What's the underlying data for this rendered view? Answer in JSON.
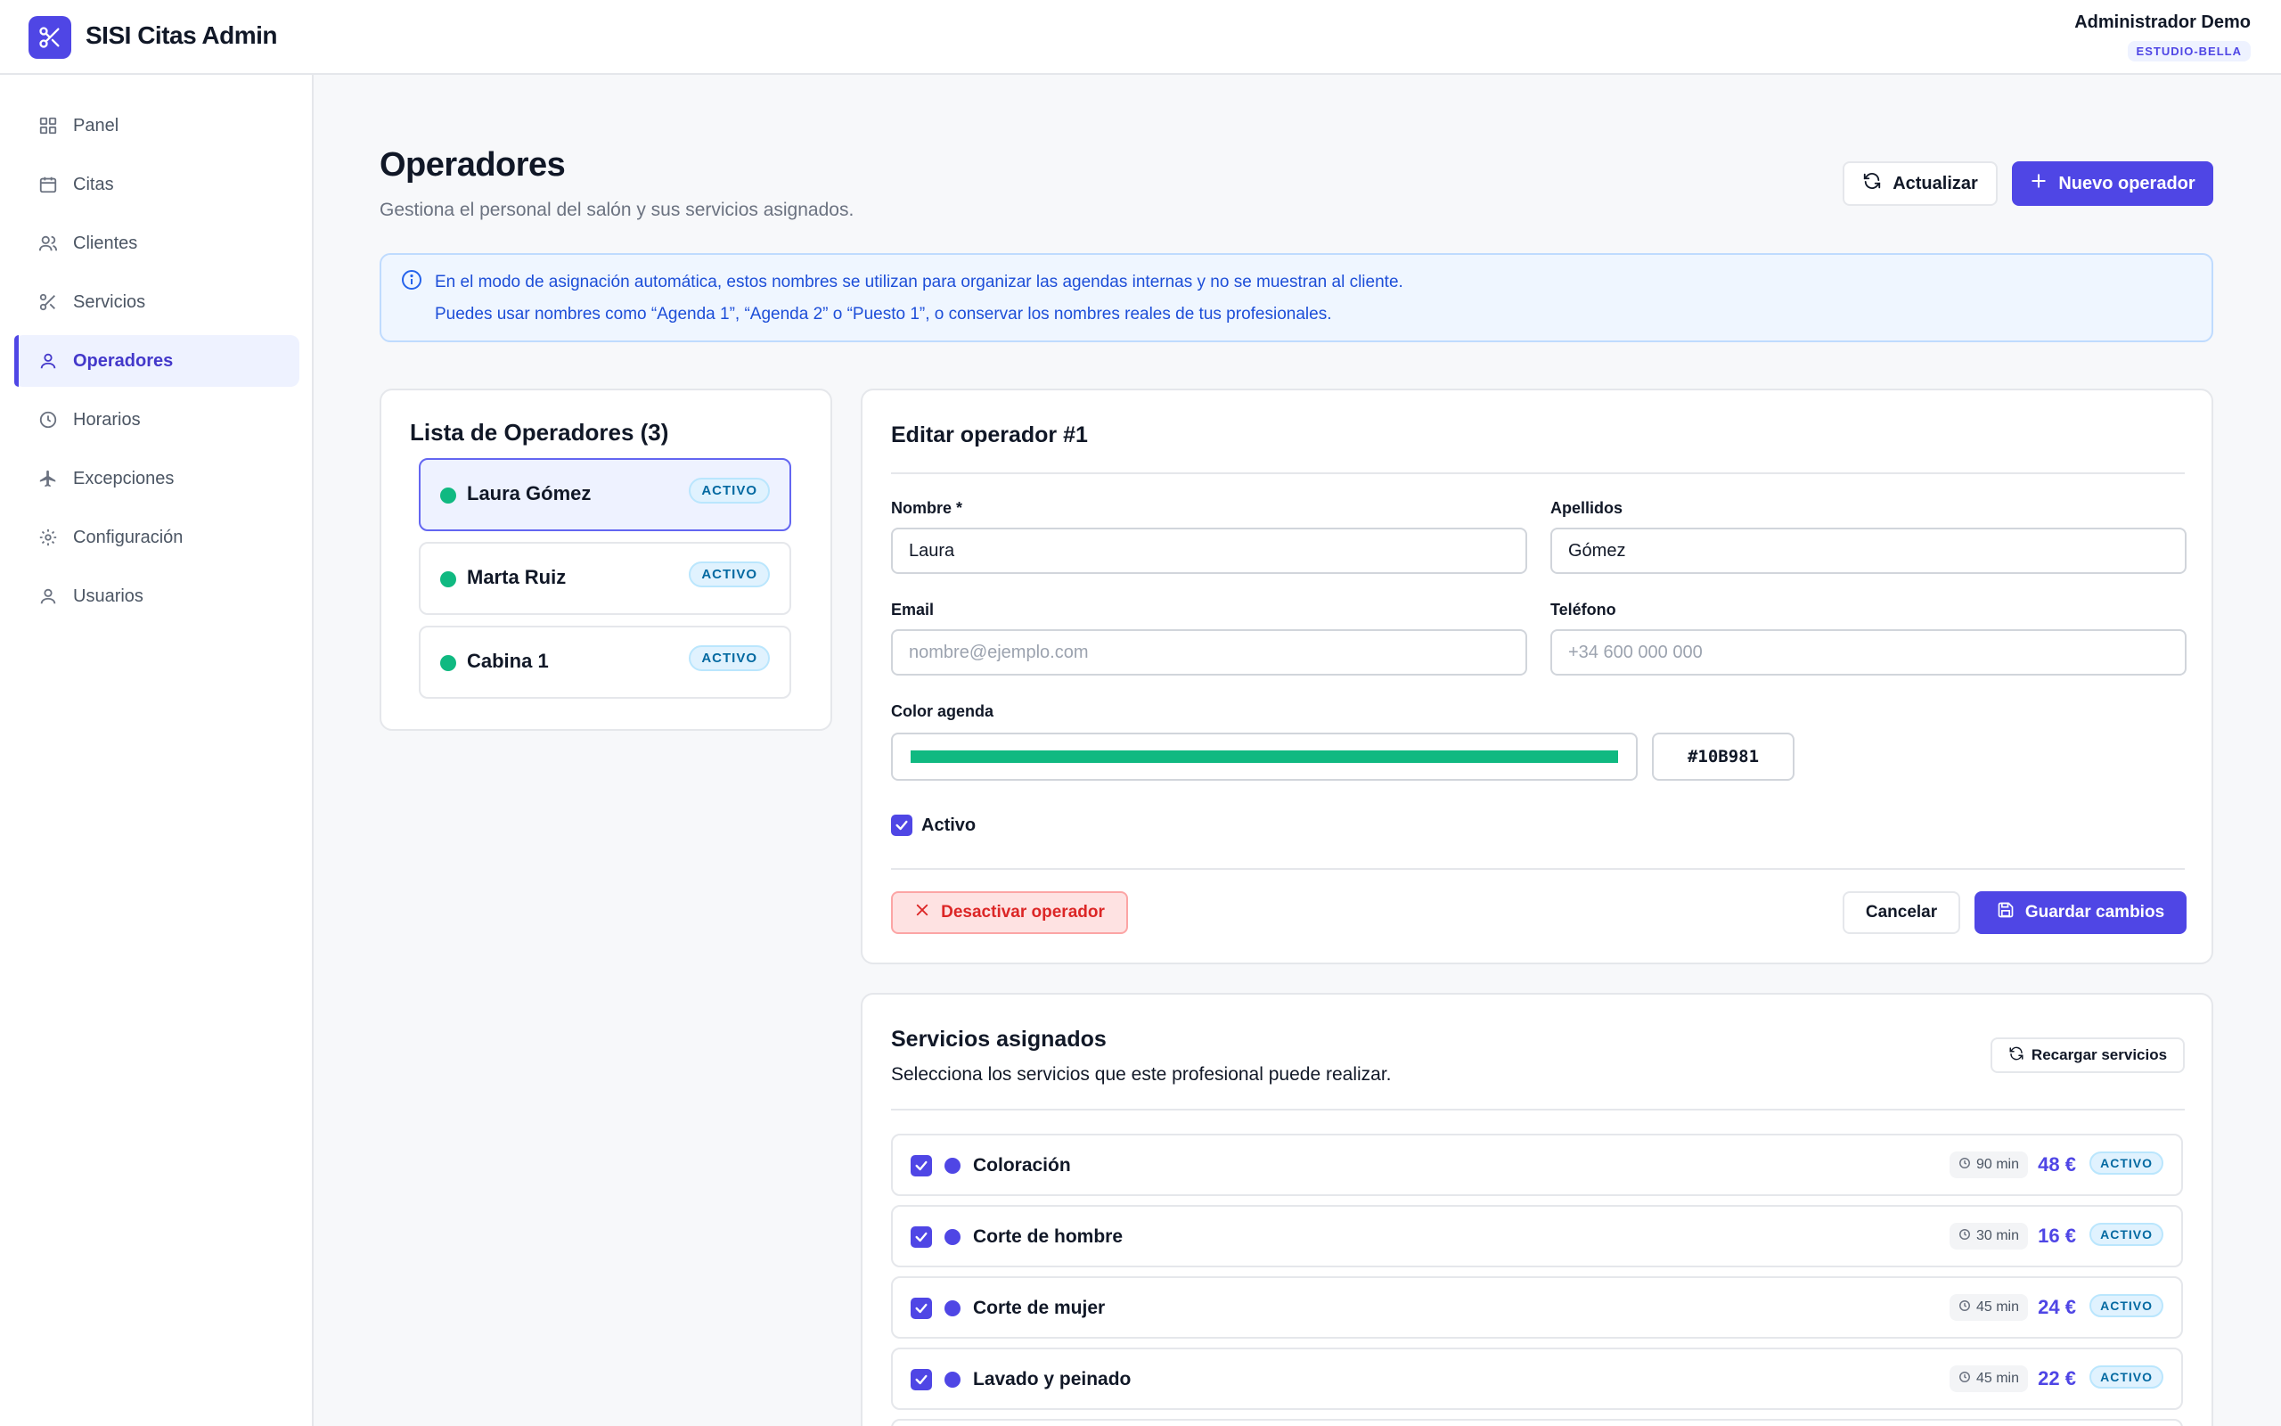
{
  "app": {
    "title": "SISI Citas Admin"
  },
  "user": {
    "name": "Administrador Demo",
    "tenant": "ESTUDIO-BELLA"
  },
  "sidebar": {
    "items": [
      {
        "label": "Panel",
        "icon": "grid-icon"
      },
      {
        "label": "Citas",
        "icon": "calendar-icon"
      },
      {
        "label": "Clientes",
        "icon": "users-icon"
      },
      {
        "label": "Servicios",
        "icon": "scissors-icon"
      },
      {
        "label": "Operadores",
        "icon": "user-icon",
        "active": true
      },
      {
        "label": "Horarios",
        "icon": "clock-icon"
      },
      {
        "label": "Excepciones",
        "icon": "plane-icon"
      },
      {
        "label": "Configuración",
        "icon": "gear-icon"
      },
      {
        "label": "Usuarios",
        "icon": "user-icon"
      }
    ]
  },
  "page": {
    "title": "Operadores",
    "subtitle": "Gestiona el personal del salón y sus servicios asignados.",
    "refresh_label": "Actualizar",
    "new_label": "Nuevo operador"
  },
  "info": {
    "line1": "En el modo de asignación automática, estos nombres se utilizan para organizar las agendas internas y no se muestran al cliente.",
    "line2": "Puedes usar nombres como “Agenda 1”, “Agenda 2” o “Puesto 1”, o conservar los nombres reales de tus profesionales."
  },
  "operator_list": {
    "title": "Lista de Operadores (3)",
    "items": [
      {
        "name": "Laura Gómez",
        "status": "ACTIVO",
        "selected": true
      },
      {
        "name": "Marta Ruiz",
        "status": "ACTIVO"
      },
      {
        "name": "Cabina 1",
        "status": "ACTIVO"
      }
    ]
  },
  "edit": {
    "title": "Editar operador #1",
    "nombre_label": "Nombre *",
    "nombre_value": "Laura",
    "apellidos_label": "Apellidos",
    "apellidos_value": "Gómez",
    "email_label": "Email",
    "email_placeholder": "nombre@ejemplo.com",
    "telefono_label": "Teléfono",
    "telefono_placeholder": "+34 600 000 000",
    "color_label": "Color agenda",
    "color_value": "#10B981",
    "activo_label": "Activo",
    "activo_checked": true,
    "deactivate_label": "Desactivar operador",
    "cancel_label": "Cancelar",
    "save_label": "Guardar cambios"
  },
  "services": {
    "title": "Servicios asignados",
    "subtitle": "Selecciona los servicios que este profesional puede realizar.",
    "reload_label": "Recargar servicios",
    "items": [
      {
        "name": "Coloración",
        "duration": "90 min",
        "price": "48 €",
        "status": "ACTIVO",
        "checked": true
      },
      {
        "name": "Corte de hombre",
        "duration": "30 min",
        "price": "16 €",
        "status": "ACTIVO",
        "checked": true
      },
      {
        "name": "Corte de mujer",
        "duration": "45 min",
        "price": "24 €",
        "status": "ACTIVO",
        "checked": true
      },
      {
        "name": "Lavado y peinado",
        "duration": "45 min",
        "price": "22 €",
        "status": "ACTIVO",
        "checked": true
      }
    ]
  },
  "colors": {
    "accent": "#4f46e5",
    "operator_dot": "#10b981",
    "danger": "#dc2626"
  }
}
